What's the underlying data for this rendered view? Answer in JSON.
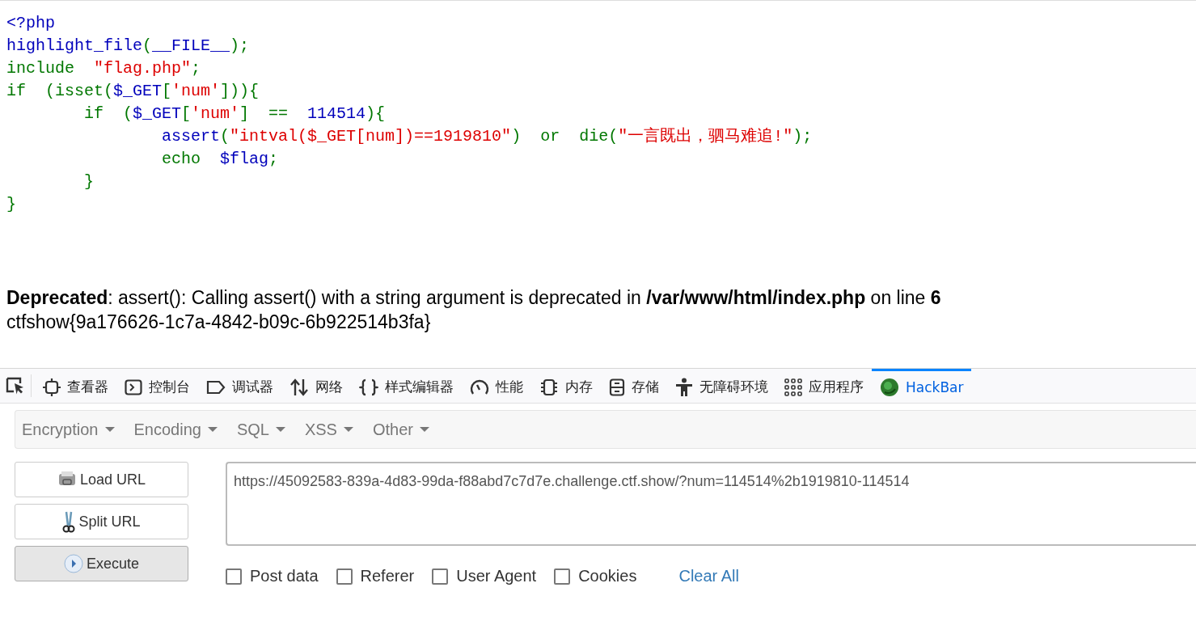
{
  "code_lines": [
    [
      {
        "text": "<?php",
        "kind": "default"
      }
    ],
    [
      {
        "text": "highlight_file",
        "kind": "default"
      },
      {
        "text": "(",
        "kind": "keyword"
      },
      {
        "text": "__FILE__",
        "kind": "default"
      },
      {
        "text": ");",
        "kind": "keyword"
      }
    ],
    [
      {
        "text": "include  ",
        "kind": "keyword"
      },
      {
        "text": "\"flag.php\"",
        "kind": "string"
      },
      {
        "text": ";",
        "kind": "keyword"
      }
    ],
    [
      {
        "text": "if  (",
        "kind": "keyword"
      },
      {
        "text": "isset",
        "kind": "keyword"
      },
      {
        "text": "(",
        "kind": "keyword"
      },
      {
        "text": "$_GET",
        "kind": "default"
      },
      {
        "text": "[",
        "kind": "keyword"
      },
      {
        "text": "'num'",
        "kind": "string"
      },
      {
        "text": "])){",
        "kind": "keyword"
      }
    ],
    [
      {
        "text": "        if  (",
        "kind": "keyword"
      },
      {
        "text": "$_GET",
        "kind": "default"
      },
      {
        "text": "[",
        "kind": "keyword"
      },
      {
        "text": "'num'",
        "kind": "string"
      },
      {
        "text": "]  ==  ",
        "kind": "keyword"
      },
      {
        "text": "114514",
        "kind": "default"
      },
      {
        "text": "){",
        "kind": "keyword"
      }
    ],
    [
      {
        "text": "                assert",
        "kind": "default"
      },
      {
        "text": "(",
        "kind": "keyword"
      },
      {
        "text": "\"intval($_GET[num])==1919810\"",
        "kind": "string"
      },
      {
        "text": ")  or  die(",
        "kind": "keyword"
      },
      {
        "text": "\"一言既出，驷马难追!\"",
        "kind": "string"
      },
      {
        "text": ");",
        "kind": "keyword"
      }
    ],
    [
      {
        "text": "                echo  ",
        "kind": "keyword"
      },
      {
        "text": "$flag",
        "kind": "default"
      },
      {
        "text": ";",
        "kind": "keyword"
      }
    ],
    [
      {
        "text": "        }",
        "kind": "keyword"
      }
    ],
    [
      {
        "text": "}",
        "kind": "keyword"
      }
    ]
  ],
  "warning": "**Deprecated**: assert(): Calling assert() with a string argument is deprecated in **/var/www/html/index.php** on line **6**",
  "flag": "ctfshow{9a176626-1c7a-4842-b09c-6b922514b3fa}",
  "devtools_tabs": [
    {
      "label": "查看器",
      "kind": "inspector",
      "selected": false
    },
    {
      "label": "控制台",
      "kind": "console",
      "selected": false
    },
    {
      "label": "调试器",
      "kind": "debugger",
      "selected": false
    },
    {
      "label": "网络",
      "kind": "network",
      "selected": false
    },
    {
      "label": "样式编辑器",
      "kind": "style",
      "selected": false
    },
    {
      "label": "性能",
      "kind": "performance",
      "selected": false
    },
    {
      "label": "内存",
      "kind": "memory",
      "selected": false
    },
    {
      "label": "存储",
      "kind": "storage",
      "selected": false
    },
    {
      "label": "无障碍环境",
      "kind": "accessibility",
      "selected": false
    },
    {
      "label": "应用程序",
      "kind": "application",
      "selected": false
    },
    {
      "label": "HackBar",
      "kind": "hackbar",
      "selected": true
    }
  ],
  "hackbar": {
    "menus": [
      "Encryption",
      "Encoding",
      "SQL",
      "XSS",
      "Other"
    ],
    "buttons": [
      {
        "label": "Load URL",
        "kind": "load"
      },
      {
        "label": "Split URL",
        "kind": "split"
      },
      {
        "label": "Execute",
        "kind": "execute"
      }
    ],
    "url": "https://45092583-839a-4d83-99da-f88abd7c7d7e.challenge.ctf.show/?num=114514%2b1919810-114514",
    "options": [
      {
        "label": "Post data",
        "checked": false
      },
      {
        "label": "Referer",
        "checked": false
      },
      {
        "label": "User Agent",
        "checked": false
      },
      {
        "label": "Cookies",
        "checked": false
      }
    ],
    "clear": "Clear All"
  }
}
